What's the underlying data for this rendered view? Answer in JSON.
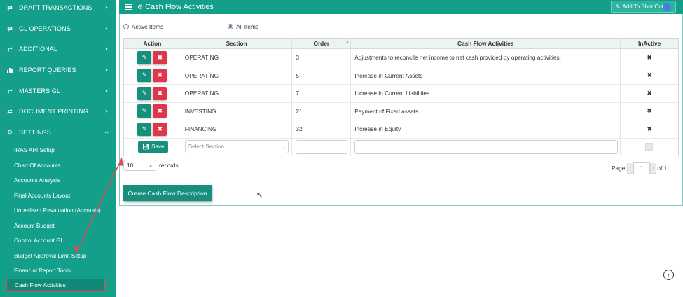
{
  "sidebar": {
    "groups": [
      {
        "label": "DRAFT TRANSACTIONS",
        "icon": "exchange-icon",
        "chev": "›"
      },
      {
        "label": "GL OPERATIONS",
        "icon": "exchange-icon",
        "chev": "›"
      },
      {
        "label": "ADDITIONAL",
        "icon": "exchange-icon",
        "chev": "›"
      },
      {
        "label": "REPORT QUERIES",
        "icon": "bar-chart-icon",
        "chev": "›"
      },
      {
        "label": "MASTERS GL",
        "icon": "exchange-icon",
        "chev": "›"
      },
      {
        "label": "DOCUMENT PRINTING",
        "icon": "exchange-icon",
        "chev": "›"
      },
      {
        "label": "SETTINGS",
        "icon": "gears-icon",
        "chev": "‹"
      }
    ],
    "sub_items": [
      {
        "label": "IRAS API Setup"
      },
      {
        "label": "Chart Of Accounts"
      },
      {
        "label": "Accounts Analysis"
      },
      {
        "label": "Final Accounts Layout"
      },
      {
        "label": "Unrealised Revaluation (Accruals)"
      },
      {
        "label": "Account Budget"
      },
      {
        "label": "Control Account GL"
      },
      {
        "label": "Budget Approval Limit Setup"
      },
      {
        "label": "Financial Report Tools"
      },
      {
        "label": "Cash Flow Activities"
      }
    ]
  },
  "header": {
    "title": "Cash Flow Activities",
    "shortcut_label": "Add To ShortCut"
  },
  "filters": {
    "active_items": "Active Items",
    "all_items": "All Items",
    "selected": "all"
  },
  "table": {
    "headers": [
      "Action",
      "Section",
      "Order",
      "Cash Flow Activities",
      "InActive"
    ],
    "rows": [
      {
        "section": "OPERATING",
        "order": "3",
        "activity": "Adjustments to reconcile net income to net cash provided by operating activities:",
        "inactive": "✖"
      },
      {
        "section": "OPERATING",
        "order": "5",
        "activity": "Increase in Current Assets",
        "inactive": "✖"
      },
      {
        "section": "OPERATING",
        "order": "7",
        "activity": "Increase in Current Liabilities",
        "inactive": "✖"
      },
      {
        "section": "INVESTING",
        "order": "21",
        "activity": "Payment of Fixed assets",
        "inactive": "✖"
      },
      {
        "section": "FINANCING",
        "order": "32",
        "activity": "Increase in Equity",
        "inactive": "✖"
      }
    ],
    "edit_row": {
      "save_label": "Save",
      "section_placeholder": "Select Section"
    }
  },
  "pagination": {
    "page_size": "10",
    "records_label": "records",
    "page_label": "Page",
    "current_page": "1",
    "of_label": "of 1"
  },
  "actions": {
    "create_label": "Create Cash Flow Description"
  },
  "colors": {
    "accent": "#139f8a",
    "danger": "#e0364b",
    "annotation": "#e4475a"
  }
}
